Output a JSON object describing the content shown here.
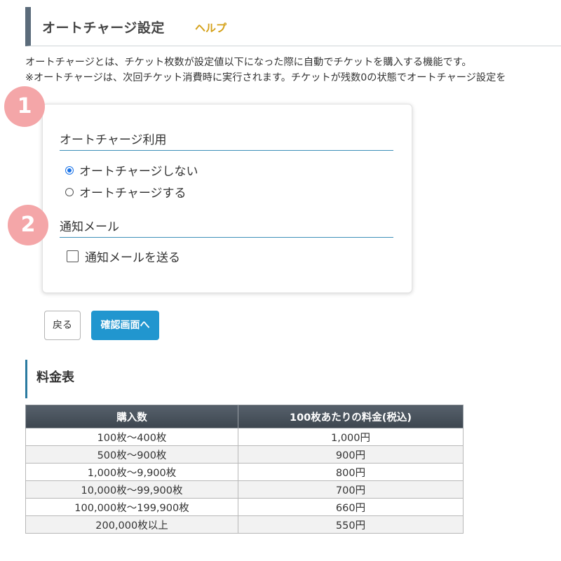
{
  "header": {
    "title": "オートチャージ設定",
    "help_label": "ヘルプ"
  },
  "description": {
    "line1": "オートチャージとは、チケット枚数が設定値以下になった際に自動でチケットを購入する機能です。",
    "line2": "※オートチャージは、次回チケット消費時に実行されます。チケットが残数0の状態でオートチャージ設定を"
  },
  "badges": {
    "one": "1",
    "two": "2"
  },
  "auto_charge": {
    "heading": "オートチャージ利用",
    "options": [
      {
        "label": "オートチャージしない",
        "selected": true
      },
      {
        "label": "オートチャージする",
        "selected": false
      }
    ]
  },
  "notify": {
    "heading": "通知メール",
    "checkbox_label": "通知メールを送る",
    "checked": false
  },
  "buttons": {
    "back": "戻る",
    "confirm": "確認画面へ"
  },
  "price": {
    "heading": "料金表",
    "columns": [
      "購入数",
      "100枚あたりの料金(税込)"
    ],
    "rows": [
      [
        "100枚～400枚",
        "1,000円"
      ],
      [
        "500枚～900枚",
        "900円"
      ],
      [
        "1,000枚～9,900枚",
        "800円"
      ],
      [
        "10,000枚～99,900枚",
        "700円"
      ],
      [
        "100,000枚～199,900枚",
        "660円"
      ],
      [
        "200,000枚以上",
        "550円"
      ]
    ]
  },
  "colors": {
    "accent": "#2196cf",
    "badge": "#f4a6a8",
    "help": "#d4a017",
    "title_border": "#5b6b7a"
  }
}
